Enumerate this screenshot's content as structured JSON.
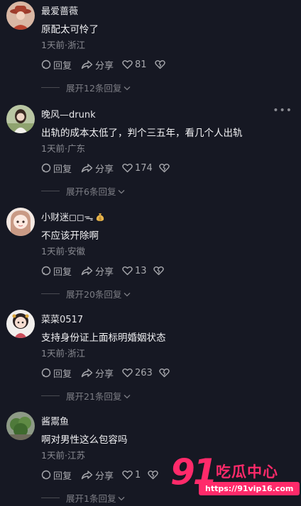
{
  "comments": [
    {
      "username": "最爱蔷薇",
      "text": "原配太可怜了",
      "time": "1天前",
      "location": "浙江",
      "reply_label": "回复",
      "share_label": "分享",
      "likes": "81",
      "expand": "展开12条回复",
      "avatar_icon": "avatar-woman-red-hat"
    },
    {
      "username": "晚风—drunk",
      "text": "出轨的成本太低了，判个三五年，看几个人出轨",
      "time": "1天前",
      "location": "广东",
      "reply_label": "回复",
      "share_label": "分享",
      "likes": "174",
      "expand": "展开6条回复",
      "avatar_icon": "avatar-girl-outdoor",
      "more_icon": "more-dots-icon"
    },
    {
      "username": "小财迷◻◻",
      "username_badge_icon": "money-bag-icon",
      "text": "不应该开除啊",
      "time": "1天前",
      "location": "安徽",
      "reply_label": "回复",
      "share_label": "分享",
      "likes": "13",
      "expand": "展开20条回复",
      "avatar_icon": "avatar-anime-girl"
    },
    {
      "username": "菜菜0517",
      "text": "支持身份证上面标明婚姻状态",
      "time": "1天前",
      "location": "浙江",
      "reply_label": "回复",
      "share_label": "分享",
      "likes": "263",
      "expand": "展开21条回复",
      "avatar_icon": "avatar-cartoon-character"
    },
    {
      "username": "酱鬻鱼",
      "text": "啊对男性这么包容吗",
      "time": "1天前",
      "location": "江苏",
      "reply_label": "回复",
      "share_label": "分享",
      "likes": "1",
      "expand": "展开1条回复",
      "avatar_icon": "avatar-green-plant"
    }
  ],
  "watermark": {
    "logo": "91",
    "name": "吃瓜中心",
    "url": "https://91vip16.com"
  },
  "colors": {
    "background": "#161823",
    "primary_text": "#f2f2f4",
    "secondary_text": "#8a8b92",
    "watermark": "#ff2a6a"
  }
}
